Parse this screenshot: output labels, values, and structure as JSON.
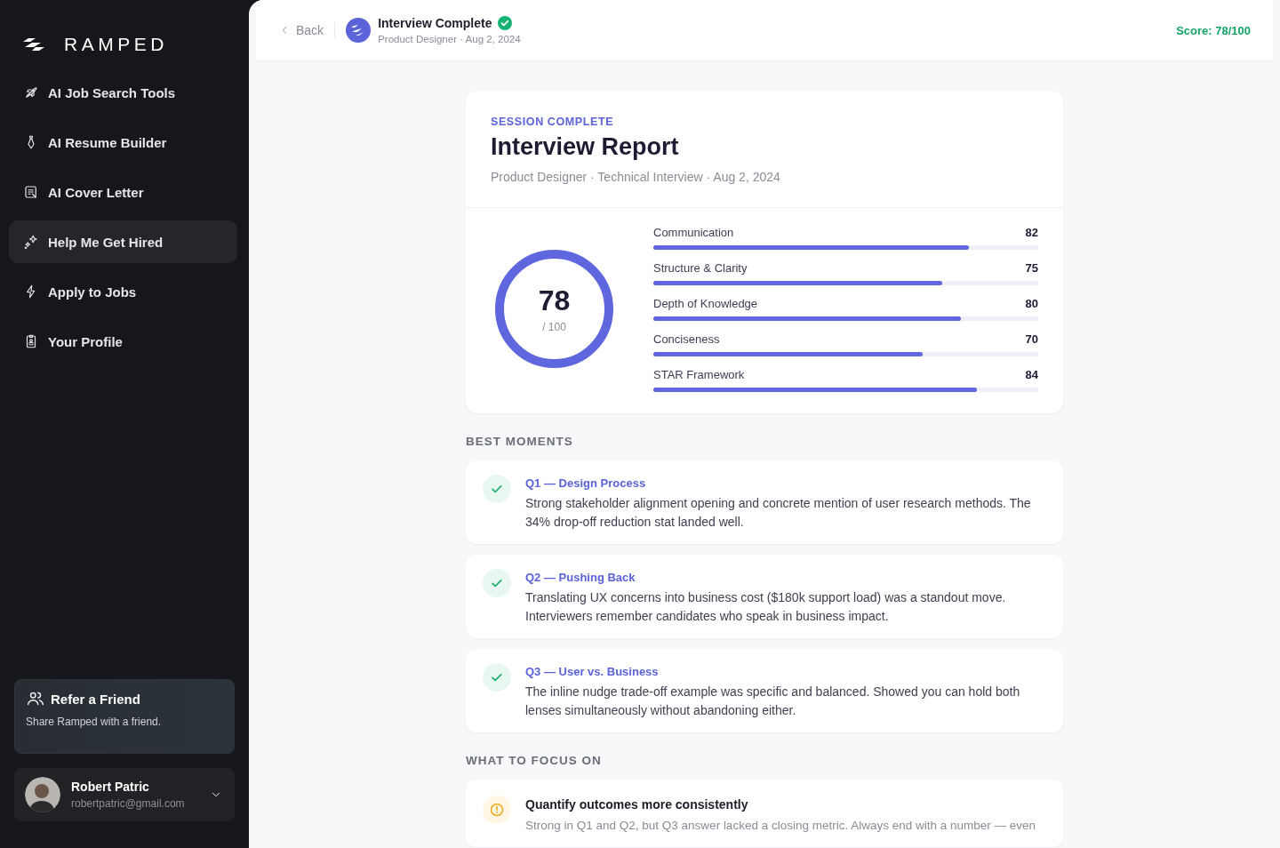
{
  "sidebar": {
    "brand": "RAMPED",
    "items": [
      {
        "label": "AI Job Search Tools",
        "selected": false
      },
      {
        "label": "AI Resume Builder",
        "selected": false
      },
      {
        "label": "AI Cover Letter",
        "selected": false
      },
      {
        "label": "Help Me Get Hired",
        "selected": true
      },
      {
        "label": "Apply to Jobs",
        "selected": false
      },
      {
        "label": "Your Profile",
        "selected": false
      }
    ],
    "referral": {
      "title": "Refer a Friend",
      "subtitle": "Share Ramped with a friend."
    },
    "user": {
      "name": "Robert Patric",
      "email": "robertpatric@gmail.com"
    }
  },
  "header": {
    "back": "Back",
    "title": "Interview Complete",
    "subtitle": "Product Designer · Aug 2, 2024",
    "score": "Score: 78/100"
  },
  "report": {
    "eyebrow": "SESSION COMPLETE",
    "title": "Interview Report",
    "meta": "Product Designer · Technical Interview · Aug 2, 2024",
    "total": "78",
    "total_of": "/ 100",
    "metrics": [
      {
        "name": "Communication",
        "value": "82",
        "level": 0.82
      },
      {
        "name": "Structure & Clarity",
        "value": "75",
        "level": 0.75
      },
      {
        "name": "Depth of Knowledge",
        "value": "80",
        "level": 0.8
      },
      {
        "name": "Conciseness",
        "value": "70",
        "level": 0.7
      },
      {
        "name": "STAR Framework",
        "value": "84",
        "level": 0.84
      }
    ]
  },
  "sections": [
    {
      "heading": "BEST MOMENTS",
      "items": [
        {
          "kind": "strength",
          "title": "Q1 — Design Process",
          "text": "Strong stakeholder alignment opening and concrete mention of user research methods. The 34% drop-off reduction stat landed well."
        },
        {
          "kind": "strength",
          "title": "Q2 — Pushing Back",
          "text": "Translating UX concerns into business cost ($180k support load) was a standout move. Interviewers remember candidates who speak in business impact."
        },
        {
          "kind": "strength",
          "title": "Q3 — User vs. Business",
          "text": "The inline nudge trade-off example was specific and balanced. Showed you can hold both lenses simultaneously without abandoning either."
        }
      ]
    },
    {
      "heading": "WHAT TO FOCUS ON",
      "items": [
        {
          "kind": "focus",
          "title": "Quantify outcomes more consistently",
          "text": "Strong in Q1 and Q2, but Q3 answer lacked a closing metric. Always end with a number — even"
        }
      ]
    }
  ]
}
